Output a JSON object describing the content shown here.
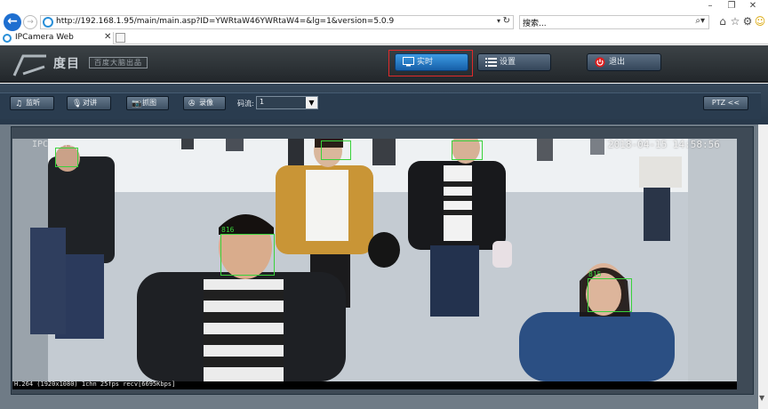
{
  "browser": {
    "window_controls": {
      "minimize": "–",
      "restore": "❐"
    },
    "url": "http://192.168.1.95/main/main.asp?ID=YWRtaW46YWRtaW4=&lg=1&version=5.0.9",
    "search_placeholder": "搜索...",
    "tab_title": "IPCamera Web",
    "icons": [
      "back-icon",
      "forward-icon",
      "ie-icon",
      "refresh-icon",
      "search-icon",
      "home-icon",
      "favorites-star-icon",
      "settings-gear-icon",
      "smiley-feedback-icon"
    ]
  },
  "header": {
    "logo_text": "度目",
    "logo_sub": "百度大脑出品",
    "buttons": [
      {
        "label": "实时",
        "icon": "monitor-icon",
        "active": true
      },
      {
        "label": "设置",
        "icon": "list-icon",
        "active": false
      },
      {
        "label": "退出",
        "icon": "power-icon",
        "active": false
      }
    ]
  },
  "toolbar": {
    "buttons": [
      {
        "label": "监听",
        "icon": "headphones-icon"
      },
      {
        "label": "对讲",
        "icon": "microphone-icon"
      },
      {
        "label": "抓图",
        "icon": "camera-icon"
      },
      {
        "label": "录像",
        "icon": "record-reel-icon"
      }
    ],
    "stream_label": "码流:",
    "stream_value": "1",
    "ptz_label": "PTZ <<"
  },
  "video": {
    "osd_camera": "IPCamera",
    "osd_timestamp": "2018-04-15 14:58:56",
    "faces": [
      {
        "id": "",
        "label": "face-box-a"
      },
      {
        "id": "818",
        "label": "face-box-818"
      },
      {
        "id": "817",
        "label": "face-box-817"
      },
      {
        "id": "816",
        "label": "face-box-816"
      },
      {
        "id": "815",
        "label": "face-box-815"
      }
    ],
    "status": "H.264 (1920x1080) 1chn 25fps recv[6695Kbps]"
  },
  "colors": {
    "accent_active": "#1f77c9",
    "highlight_border": "#e02a2a",
    "face_box": "#39d23b",
    "logout_icon": "#e01c1c"
  }
}
